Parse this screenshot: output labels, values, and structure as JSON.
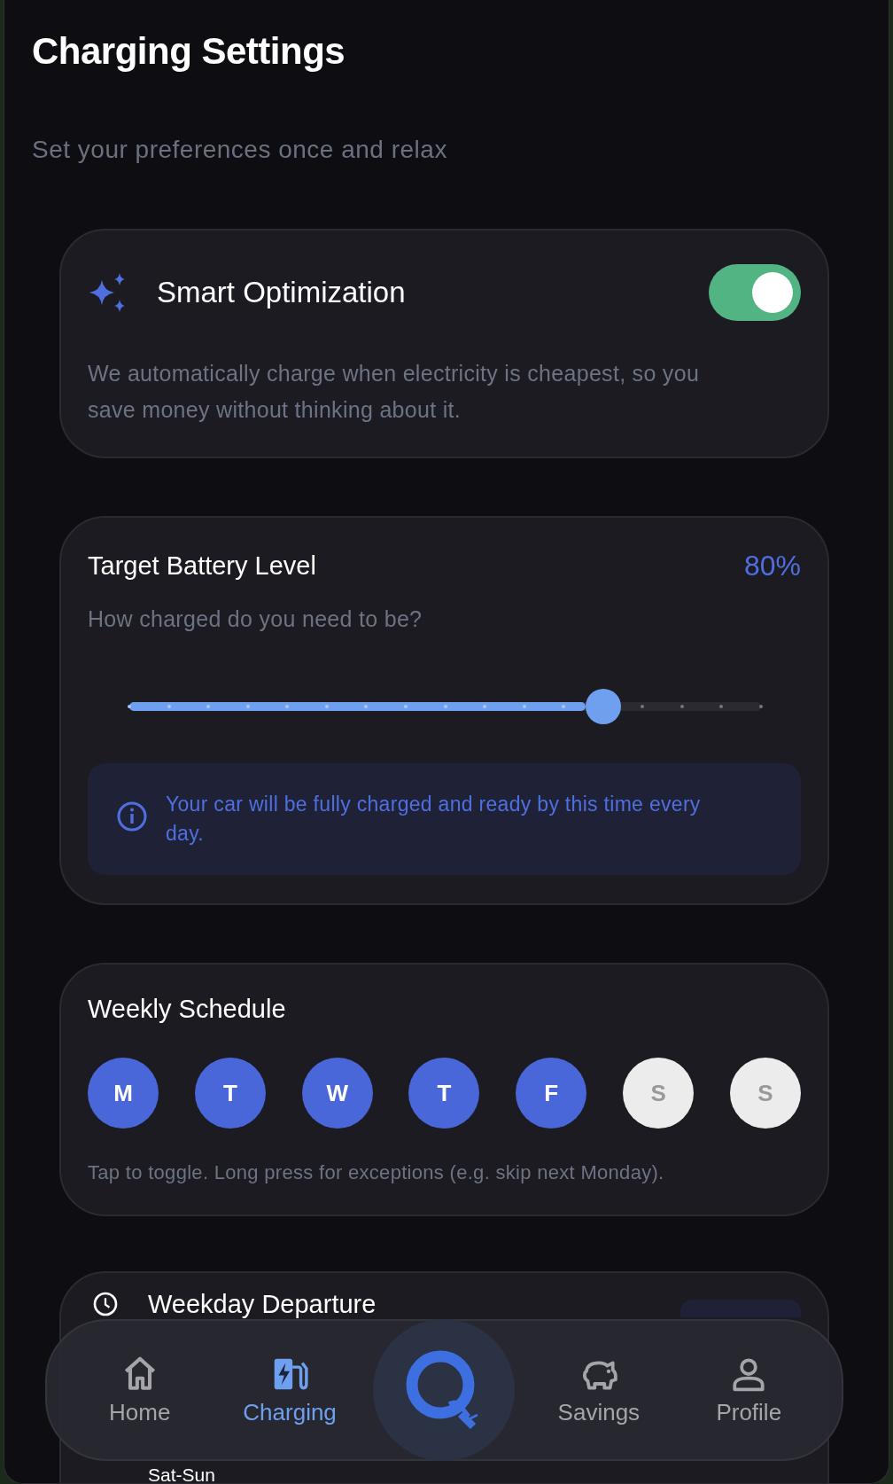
{
  "header": {
    "title": "Charging Settings",
    "subtitle": "Set your preferences once and relax"
  },
  "smart_optimization": {
    "title": "Smart Optimization",
    "on": true,
    "description": "We automatically charge when electricity is cheapest, so you save money without thinking about it."
  },
  "target_battery": {
    "title": "Target Battery Level",
    "value": "80%",
    "subtitle": "How charged do you need to be?",
    "level": 0.75,
    "info": "Your car will be fully charged and ready by this time every day."
  },
  "weekly_schedule": {
    "title": "Weekly Schedule",
    "days": [
      {
        "label": "M",
        "selected": true
      },
      {
        "label": "T",
        "selected": true
      },
      {
        "label": "W",
        "selected": true
      },
      {
        "label": "T",
        "selected": true
      },
      {
        "label": "F",
        "selected": true
      },
      {
        "label": "S",
        "selected": false
      },
      {
        "label": "S",
        "selected": false
      }
    ],
    "note": "Tap to toggle. Long press for exceptions (e.g. skip next Monday)."
  },
  "departures": {
    "title": "Weekday Departure",
    "subtitle": "Sat-Sun"
  },
  "bottom_nav": [
    {
      "kind": "home",
      "label": "Home",
      "selected": false
    },
    {
      "kind": "charging",
      "label": "Charging",
      "selected": true
    },
    {
      "kind": "logo"
    },
    {
      "kind": "savings",
      "label": "Savings",
      "selected": false
    },
    {
      "kind": "profile",
      "label": "Profile",
      "selected": false
    }
  ]
}
